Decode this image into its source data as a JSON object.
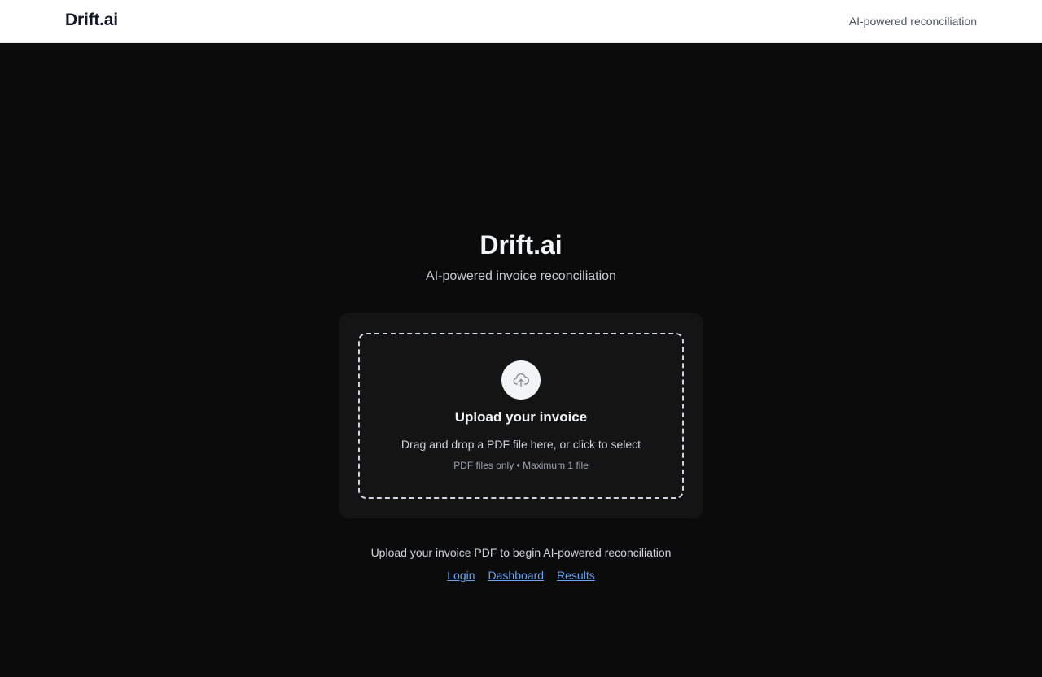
{
  "header": {
    "brand": "Drift.ai",
    "tagline": "AI-powered reconciliation"
  },
  "hero": {
    "title": "Drift.ai",
    "subtitle": "AI-powered invoice reconciliation"
  },
  "upload": {
    "icon": "cloud-upload-icon",
    "title": "Upload your invoice",
    "description": "Drag and drop a PDF file here, or click to select",
    "note": "PDF files only • Maximum 1 file"
  },
  "footer": {
    "text": "Upload your invoice PDF to begin AI-powered reconciliation",
    "links": [
      "Login",
      "Dashboard",
      "Results"
    ]
  },
  "colors": {
    "background": "#0b0b0b",
    "card": "#141414",
    "link": "#60a5fa",
    "header_bg": "#ffffff"
  }
}
